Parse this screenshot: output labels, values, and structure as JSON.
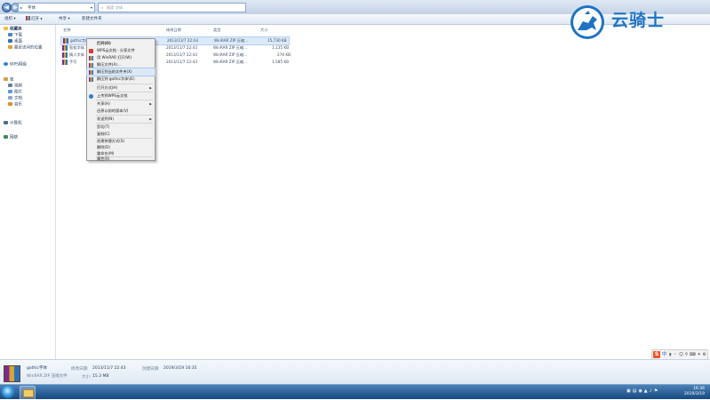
{
  "address": {
    "crumbs": [
      "字体"
    ],
    "search_placeholder": "搜索 字体"
  },
  "toolbar": {
    "organize": "组织",
    "open": "打开",
    "share": "共享",
    "new_folder": "新建文件夹"
  },
  "sidebar": {
    "favorites": "收藏夹",
    "fav_items": [
      "下载",
      "桌面",
      "最近访问的位置"
    ],
    "wps": "WPS网盘",
    "libraries": "库",
    "lib_items": [
      "视频",
      "图片",
      "文档",
      "音乐"
    ],
    "computer": "计算机",
    "network": "网络"
  },
  "columns": {
    "name": "名称",
    "date": "修改日期",
    "type": "类型",
    "size": "大小"
  },
  "files": [
    {
      "name": "gothic字体",
      "date": "2013/11/7 22:43",
      "type": "WinRAR ZIP 压缩...",
      "size": "15,730 KB"
    },
    {
      "name": "劲松字体",
      "date": "2013/11/7 22:43",
      "type": "WinRAR ZIP 压缩...",
      "size": "1,135 KB"
    },
    {
      "name": "情人字体",
      "date": "2013/11/7 22:43",
      "type": "WinRAR ZIP 压缩...",
      "size": "276 KB"
    },
    {
      "name": "手写",
      "date": "2013/11/7 22:43",
      "type": "WinRAR ZIP 压缩...",
      "size": "1,585 KB"
    }
  ],
  "menu": {
    "open": "打开(O)",
    "wps_share": "WPS云文档 · 分享文件",
    "winrar_open": "用 WinRAR 打开(W)",
    "extract_files": "解压文件(A)...",
    "extract_here": "解压到当前文件夹(X)",
    "extract_to": "解压到 gothic字体\\(E)",
    "open_with": "打开方式(H)",
    "upload_wps": "上传到WPS云文档",
    "share": "共享(H)",
    "restore": "还原以前的版本(V)",
    "send_to": "发送到(N)",
    "cut": "剪切(T)",
    "copy": "复制(C)",
    "shortcut": "创建快捷方式(S)",
    "delete": "删除(D)",
    "rename": "重命名(M)",
    "properties": "属性(R)"
  },
  "details": {
    "name": "gothic字体",
    "type": "WinRAR ZIP 压缩文件",
    "modified_label": "修改日期:",
    "modified": "2013/11/7 22:43",
    "created_label": "创建日期:",
    "created": "2019/3/19 16:35",
    "size_label": "大小:",
    "size": "15.3 MB"
  },
  "ime": {
    "lang": "中"
  },
  "clock": {
    "time": "16:36",
    "date": "2019/3/19"
  },
  "watermark": {
    "text": "云骑士"
  },
  "colors": {
    "accent": "#1f73c2",
    "selection": "#dce9f8",
    "taskbar": "#16497f"
  }
}
